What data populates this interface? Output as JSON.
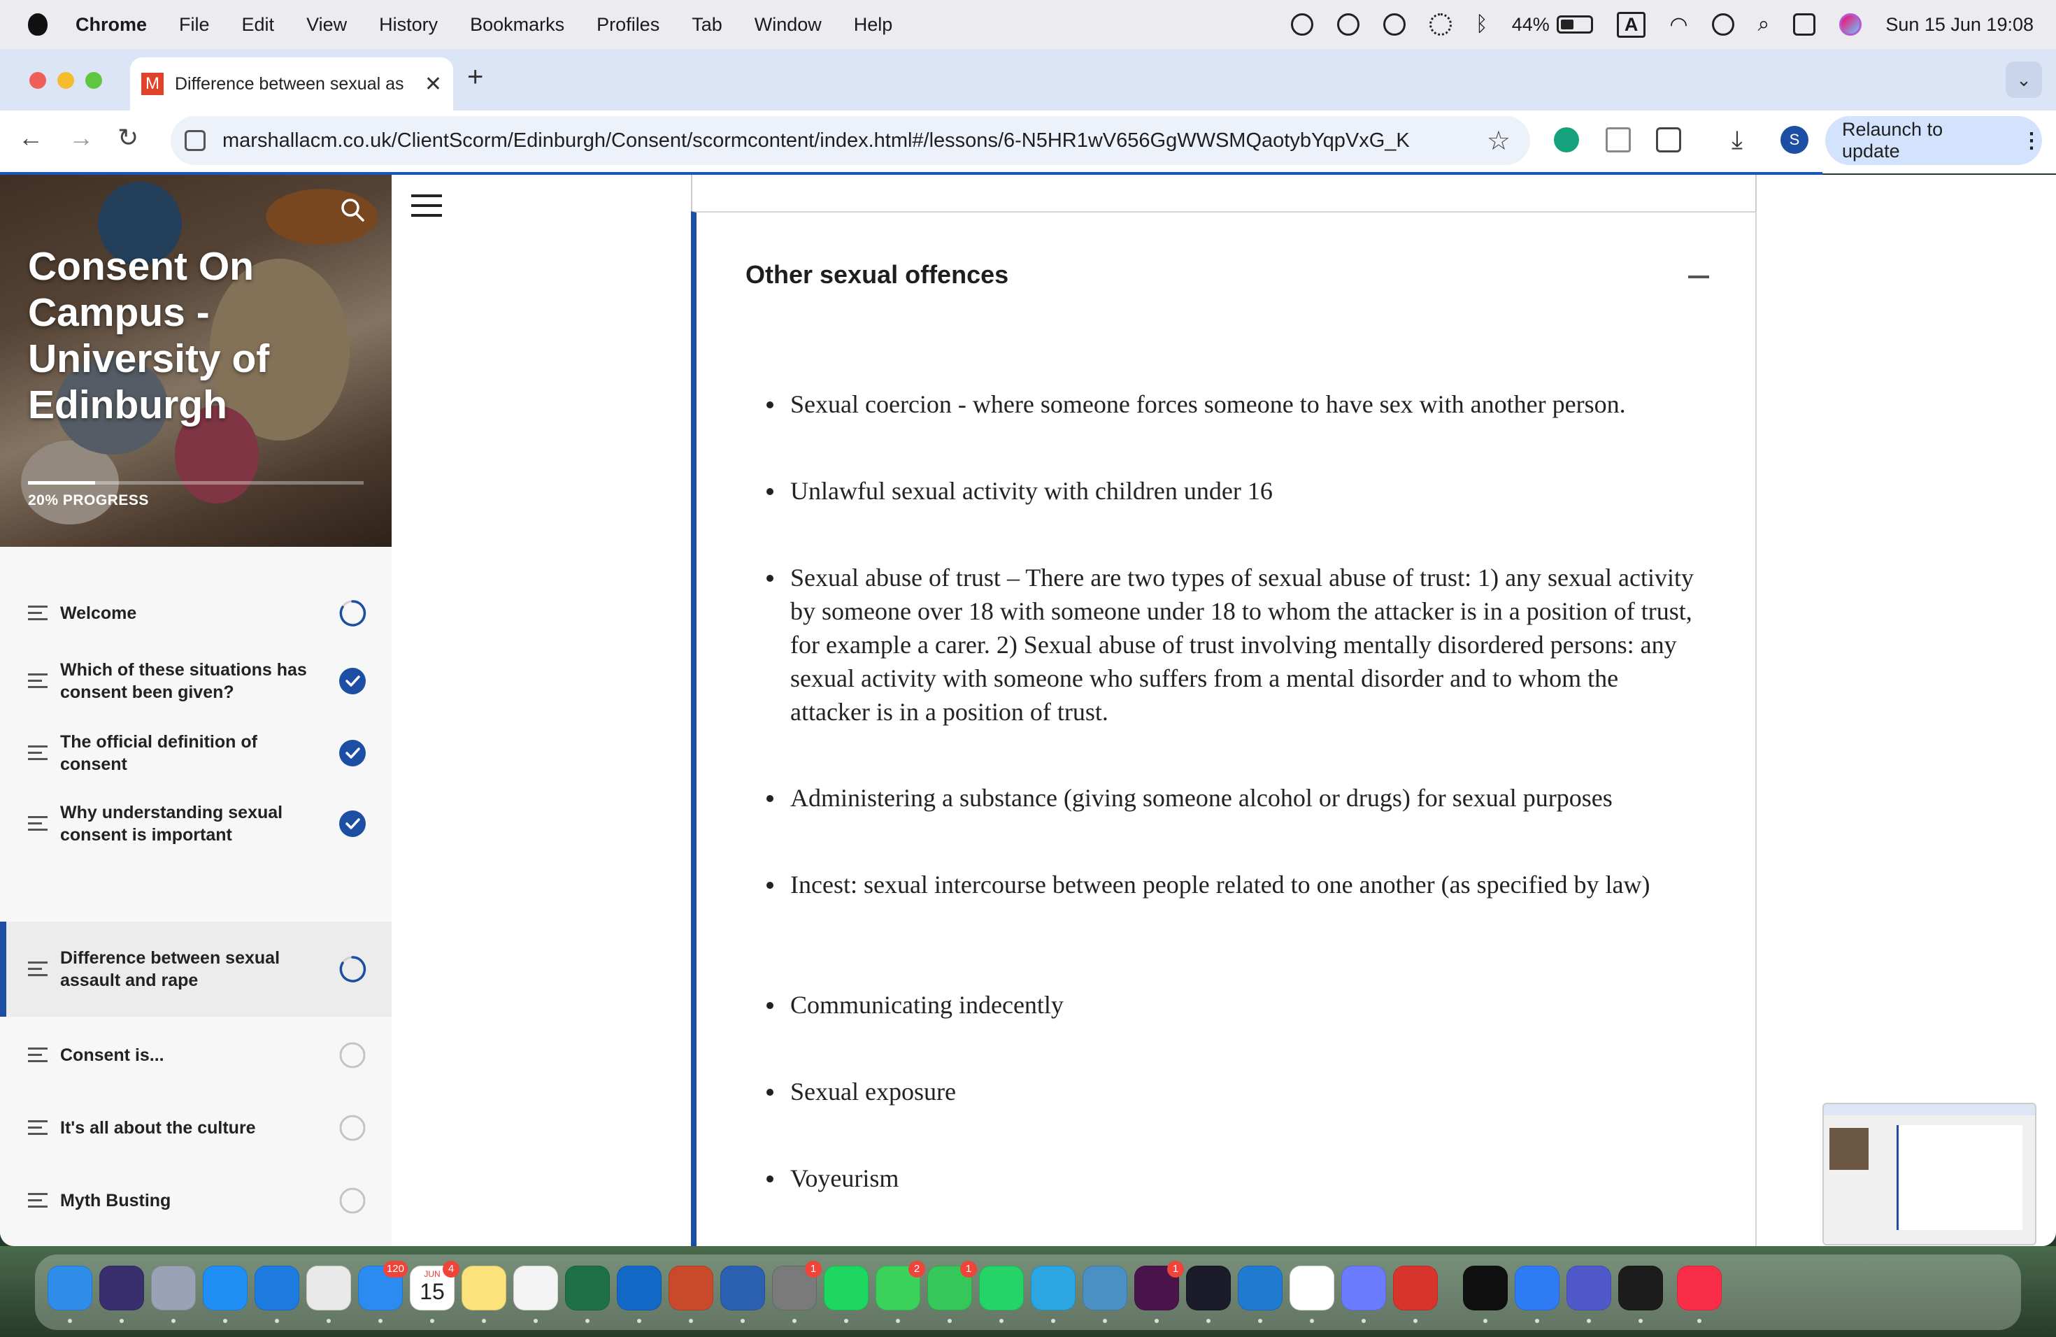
{
  "menubar": {
    "app": "Chrome",
    "items": [
      "File",
      "Edit",
      "View",
      "History",
      "Bookmarks",
      "Profiles",
      "Tab",
      "Window",
      "Help"
    ],
    "battery": "44%",
    "input_source": "A",
    "datetime": "Sun 15 Jun  19:08"
  },
  "browser": {
    "tab_title": "Difference between sexual as",
    "tab_favicon": "M",
    "url": "marshallacm.co.uk/ClientScorm/Edinburgh/Consent/scormcontent/index.html#/lessons/6-N5HR1wV656GgWWSMQaotybYqpVxG_K",
    "relaunch_label": "Relaunch to update",
    "profile_initial": "S"
  },
  "course": {
    "title": "Consent On Campus - University of Edinburgh",
    "progress_label": "20% PROGRESS",
    "progress": 0.2
  },
  "lessons": [
    {
      "label": "Welcome",
      "status": "in-progress"
    },
    {
      "label": "Which of these situations has consent been given?",
      "status": "complete"
    },
    {
      "label": "The official definition of consent",
      "status": "complete"
    },
    {
      "label": "Why understanding sexual consent is important",
      "status": "complete"
    },
    {
      "label": "Difference between sexual assault and rape",
      "status": "in-progress",
      "active": true
    },
    {
      "label": "Consent is...",
      "status": "not-started"
    },
    {
      "label": "It's all about the culture",
      "status": "not-started"
    },
    {
      "label": "Myth Busting",
      "status": "not-started"
    }
  ],
  "section": {
    "title": "Other sexual offences",
    "bullets": [
      "Sexual coercion - where someone forces someone to have sex with another person.",
      "Unlawful sexual activity with children under 16",
      "Sexual abuse of trust – There are two types of sexual abuse of trust: 1) any sexual activity by someone over 18 with someone under 18 to whom the attacker is in a position of trust, for example a carer. 2) Sexual abuse of trust involving mentally disordered persons: any sexual activity with someone who suffers from a mental disorder and to whom the attacker is in a position of trust.",
      "Administering a substance (giving someone alcohol or drugs) for sexual purposes",
      "Incest: sexual intercourse between people related to one another (as specified by law)",
      "Communicating indecently",
      "Sexual exposure",
      "Voyeurism"
    ]
  },
  "colors": {
    "accent": "#1c4fa3",
    "tabstrip": "#dbe5f5",
    "relaunch_bg": "#d3e3fd"
  },
  "dock": {
    "apps": [
      "finder-icon",
      "siri-icon",
      "launchpad-icon",
      "app-store-icon",
      "safari-icon",
      "chrome-icon",
      "mail-icon",
      "calendar-icon",
      "notes-icon",
      "photos-icon",
      "excel-icon",
      "outlook-icon",
      "powerpoint-icon",
      "word-icon",
      "system-settings-icon",
      "spotify-icon",
      "messages-icon",
      "facetime-icon",
      "whatsapp-icon",
      "telegram-icon",
      "preview-icon",
      "slack-icon",
      "cursor-icon",
      "vscode-icon",
      "notion-icon",
      "arc-icon",
      "zotero-icon",
      "chatgpt-icon",
      "keynote-icon",
      "teams-icon",
      "activity-monitor-icon",
      "music-icon"
    ],
    "badges": {
      "mail-icon": "120",
      "calendar-icon": "4",
      "system-settings-icon": "1",
      "messages-icon": "2",
      "facetime-icon": "1",
      "slack-icon": "1"
    },
    "calendar_month": "JUN",
    "calendar_day": "15"
  }
}
